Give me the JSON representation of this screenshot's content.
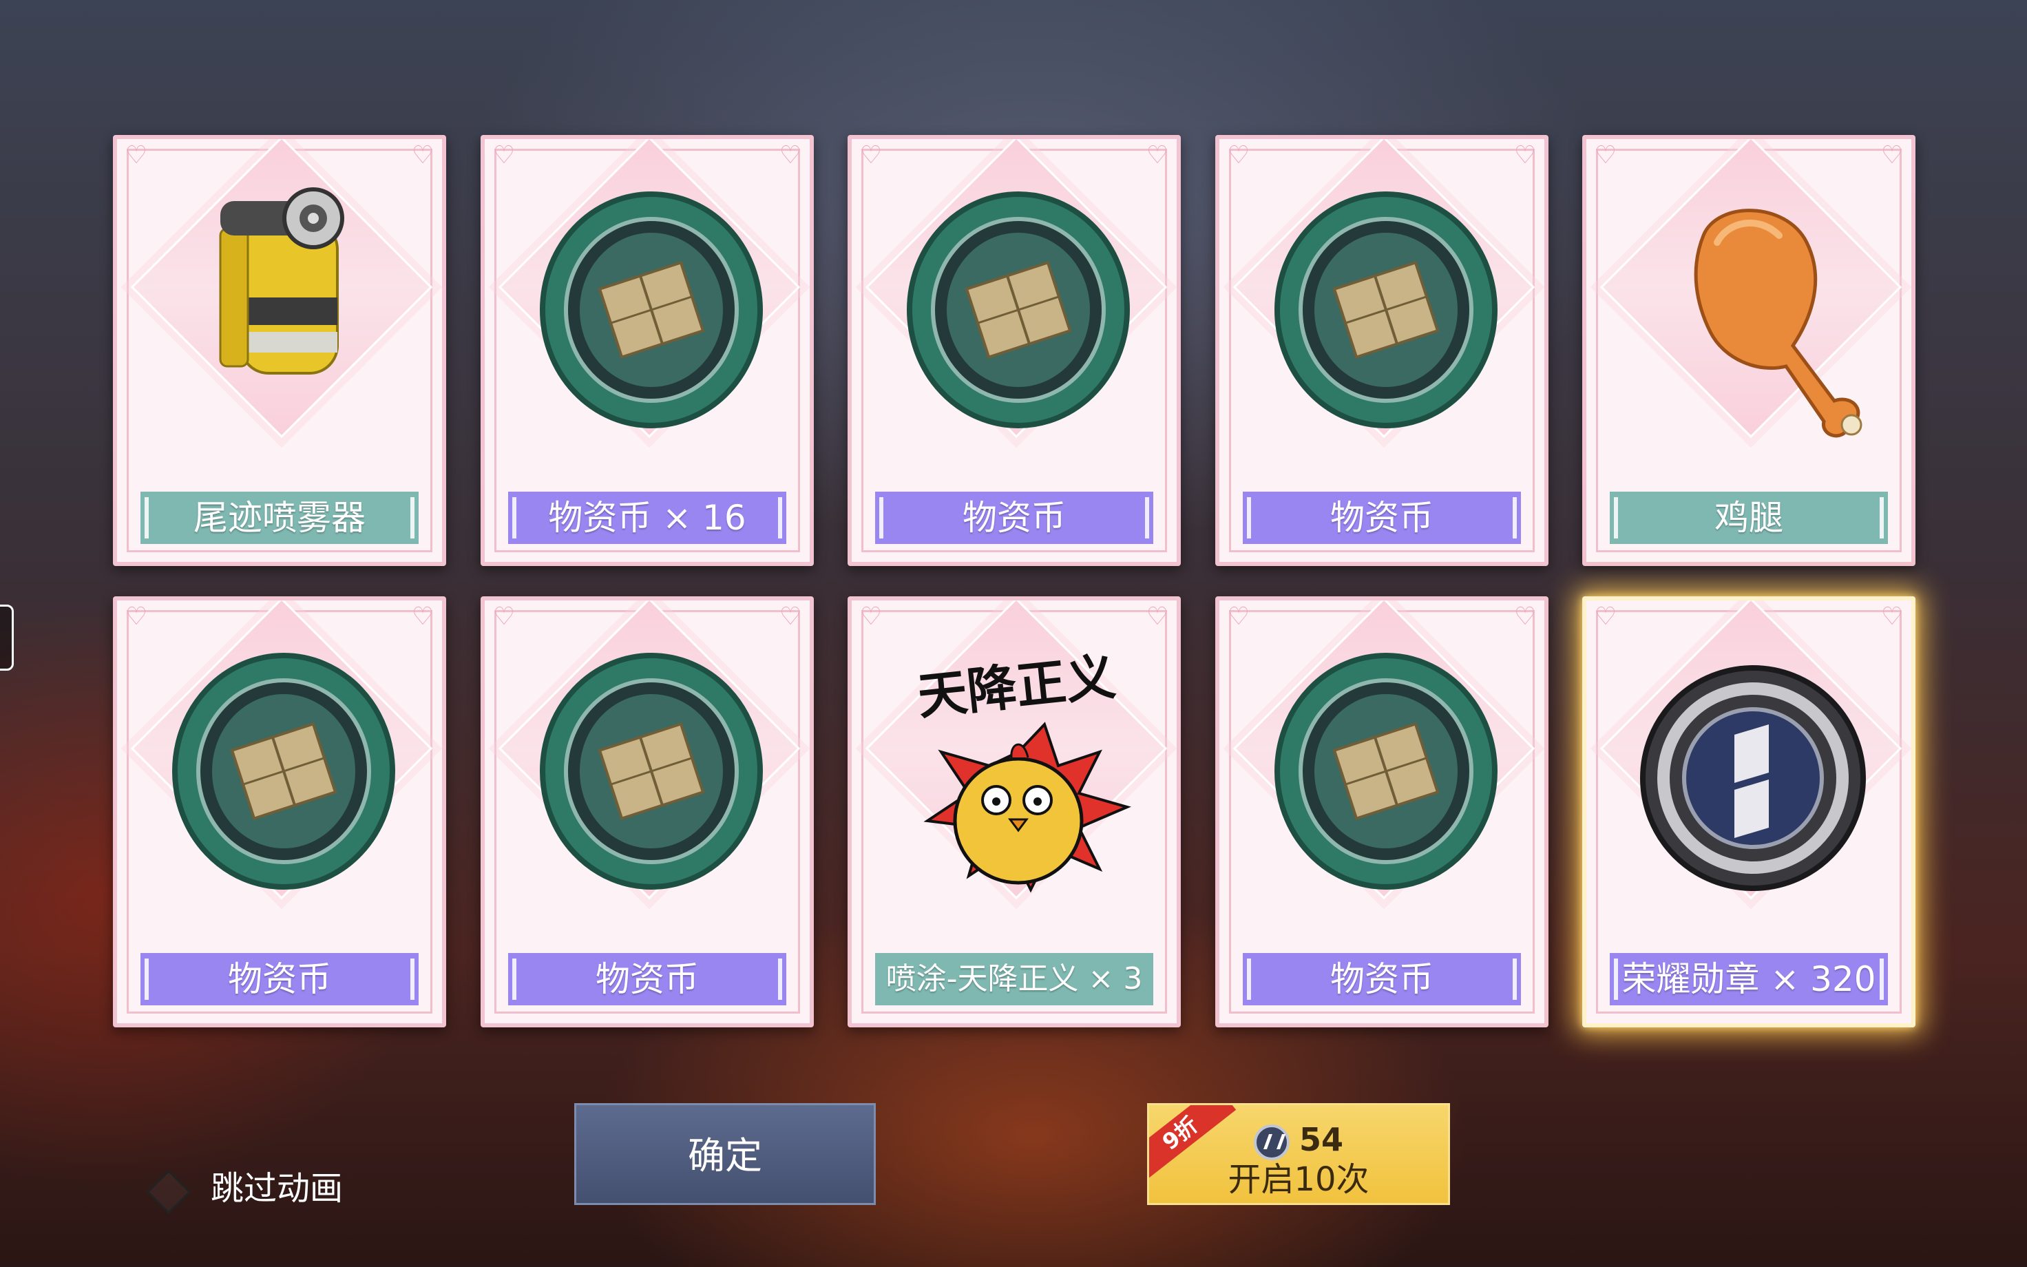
{
  "cards": [
    {
      "label": "尾迹喷雾器",
      "style": "teal",
      "icon": "yellow-spray-canister"
    },
    {
      "label": "物资币 × 16",
      "style": "purple",
      "icon": "supply-coin"
    },
    {
      "label": "物资币",
      "style": "purple",
      "icon": "supply-coin"
    },
    {
      "label": "物资币",
      "style": "purple",
      "icon": "supply-coin"
    },
    {
      "label": "鸡腿",
      "style": "teal",
      "icon": "chicken-drumstick"
    },
    {
      "label": "物资币",
      "style": "purple",
      "icon": "supply-coin"
    },
    {
      "label": "物资币",
      "style": "purple",
      "icon": "supply-coin"
    },
    {
      "label": "喷涂-天降正义 × 3",
      "style": "teal",
      "icon": "graffiti-chicken-sticker",
      "sticker_text": "天降正义"
    },
    {
      "label": "物资币",
      "style": "purple",
      "icon": "supply-coin"
    },
    {
      "label": "荣耀勋章 × 320",
      "style": "purple",
      "icon": "honor-medal",
      "highlight": true
    }
  ],
  "confirm_button": {
    "label": "确定"
  },
  "open_button": {
    "cost": "54",
    "label": "开启10次",
    "badge": "9折",
    "currency_icon": "medal-coin-icon"
  },
  "skip_animation": {
    "label": "跳过动画"
  },
  "colors": {
    "purple_label": "#9a86f1",
    "teal_label": "#7fb8b1",
    "card_border": "#f2c3d0",
    "confirm_btn": "#4e5a7c",
    "open_btn": "#f3c84c",
    "ribbon": "#d9332a"
  }
}
